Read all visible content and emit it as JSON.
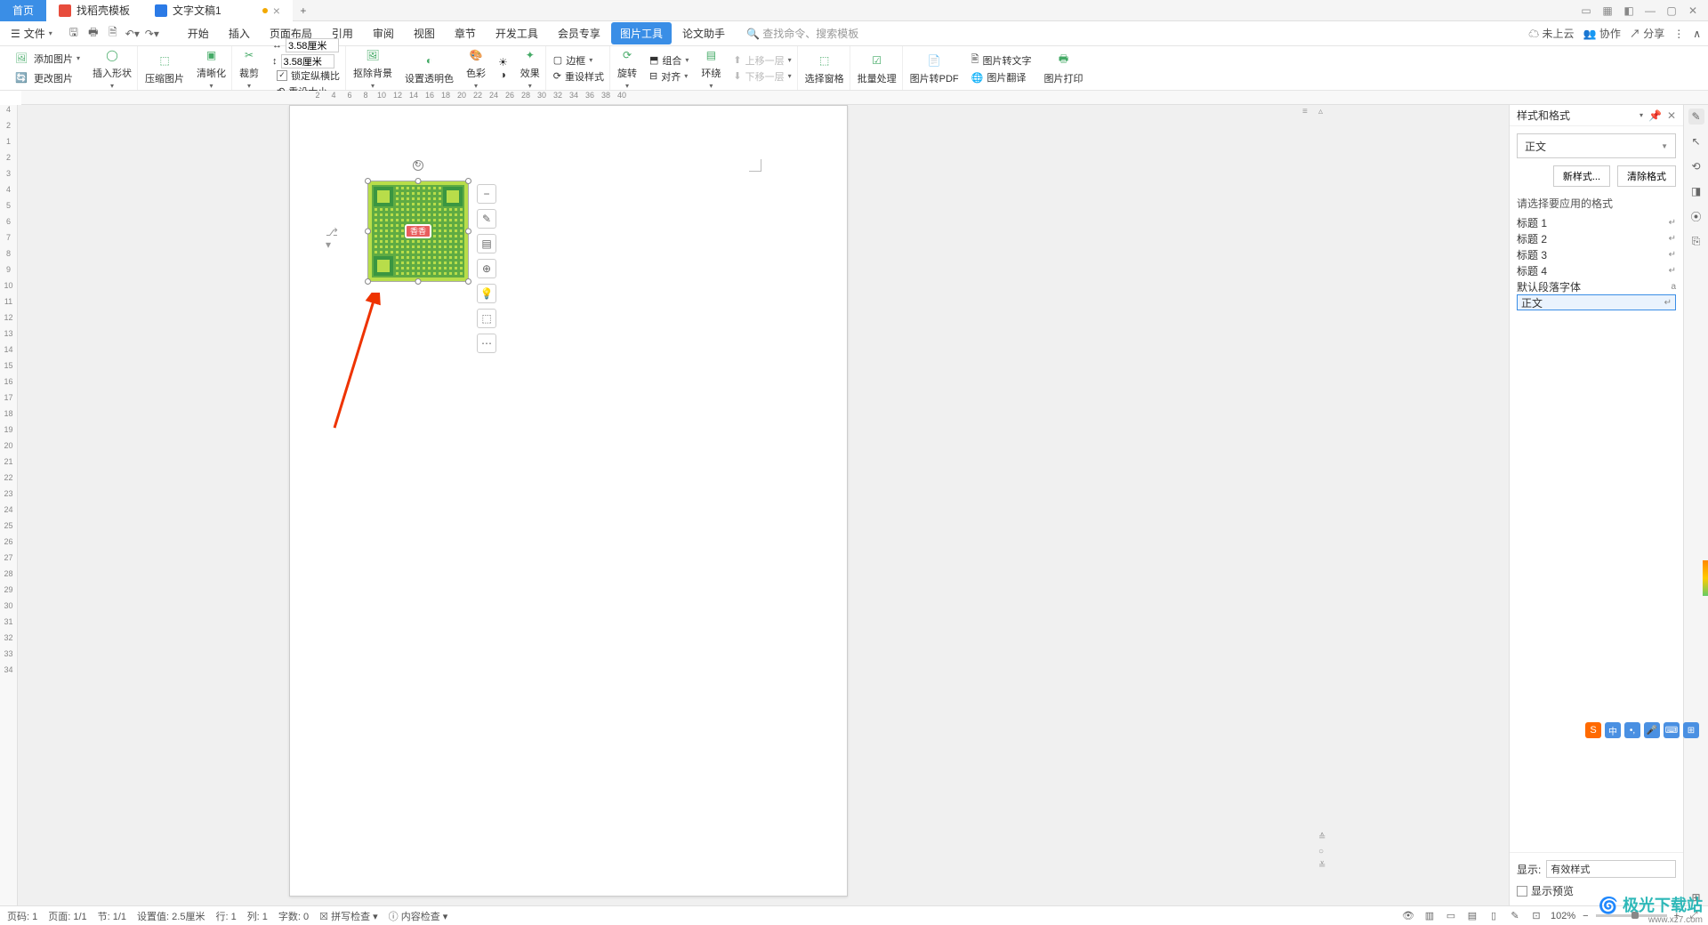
{
  "titlebar": {
    "tabs": [
      {
        "label": "首页"
      },
      {
        "label": "找稻壳模板"
      },
      {
        "label": "文字文稿1"
      }
    ],
    "add": "+"
  },
  "menubar": {
    "file": "文件",
    "tabs": [
      "开始",
      "插入",
      "页面布局",
      "引用",
      "审阅",
      "视图",
      "章节",
      "开发工具",
      "会员专享",
      "图片工具",
      "论文助手"
    ],
    "active_index": 9,
    "search_placeholder": "查找命令、搜索模板",
    "right": {
      "cloud": "未上云",
      "collab": "协作",
      "share": "分享"
    }
  },
  "ribbon": {
    "add_image": "添加图片",
    "change_image": "更改图片",
    "insert_shape": "插入形状",
    "compress": "压缩图片",
    "sharpen": "清晰化",
    "crop": "裁剪",
    "width_val": "3.58厘米",
    "height_val": "3.58厘米",
    "lock_ratio": "锁定纵横比",
    "reset_size": "重设大小",
    "remove_bg": "抠除背景",
    "set_transparent": "设置透明色",
    "color": "色彩",
    "effects": "效果",
    "border": "边框",
    "reset_style": "重设样式",
    "rotate": "旋转",
    "combine": "组合",
    "align": "对齐",
    "wrap": "环绕",
    "move_up": "上移一层",
    "move_down": "下移一层",
    "select_pane": "选择窗格",
    "batch": "批量处理",
    "to_pdf": "图片转PDF",
    "to_text": "图片转文字",
    "translate": "图片翻译",
    "print": "图片打印"
  },
  "ruler": {
    "h_neg": [
      "2"
    ],
    "h": [
      "2",
      "4",
      "6",
      "8",
      "10",
      "12",
      "14",
      "16",
      "18",
      "20",
      "22",
      "24",
      "26",
      "28",
      "30",
      "32",
      "34",
      "36",
      "38",
      "40"
    ],
    "v_neg": [
      "4",
      "2"
    ],
    "v": [
      "1",
      "2",
      "3",
      "4",
      "5",
      "6",
      "7",
      "8",
      "9",
      "10",
      "11",
      "12",
      "13",
      "14",
      "15",
      "16",
      "17",
      "18",
      "19",
      "20",
      "21",
      "22",
      "23",
      "24",
      "25",
      "26",
      "27",
      "28",
      "29",
      "30",
      "31",
      "32",
      "33",
      "34"
    ]
  },
  "qr": {
    "center_text": "香香"
  },
  "right_panel": {
    "title": "样式和格式",
    "current": "正文",
    "new_style": "新样式...",
    "clear": "清除格式",
    "apply_label": "请选择要应用的格式",
    "items": [
      "标题 1",
      "标题 2",
      "标题 3",
      "标题 4",
      "默认段落字体",
      "正文"
    ],
    "selected_index": 5,
    "show_label": "显示:",
    "show_value": "有效样式",
    "preview": "显示预览"
  },
  "statusbar": {
    "page_num": "页码: 1",
    "page": "页面: 1/1",
    "section": "节: 1/1",
    "pos": "设置值: 2.5厘米",
    "line": "行: 1",
    "col": "列: 1",
    "words": "字数: 0",
    "spell": "拼写检查",
    "content": "内容检查",
    "zoom": "102%"
  },
  "ime": {
    "input": "中"
  },
  "watermark": {
    "name": "极光下载站",
    "url": "www.xz7.com"
  }
}
